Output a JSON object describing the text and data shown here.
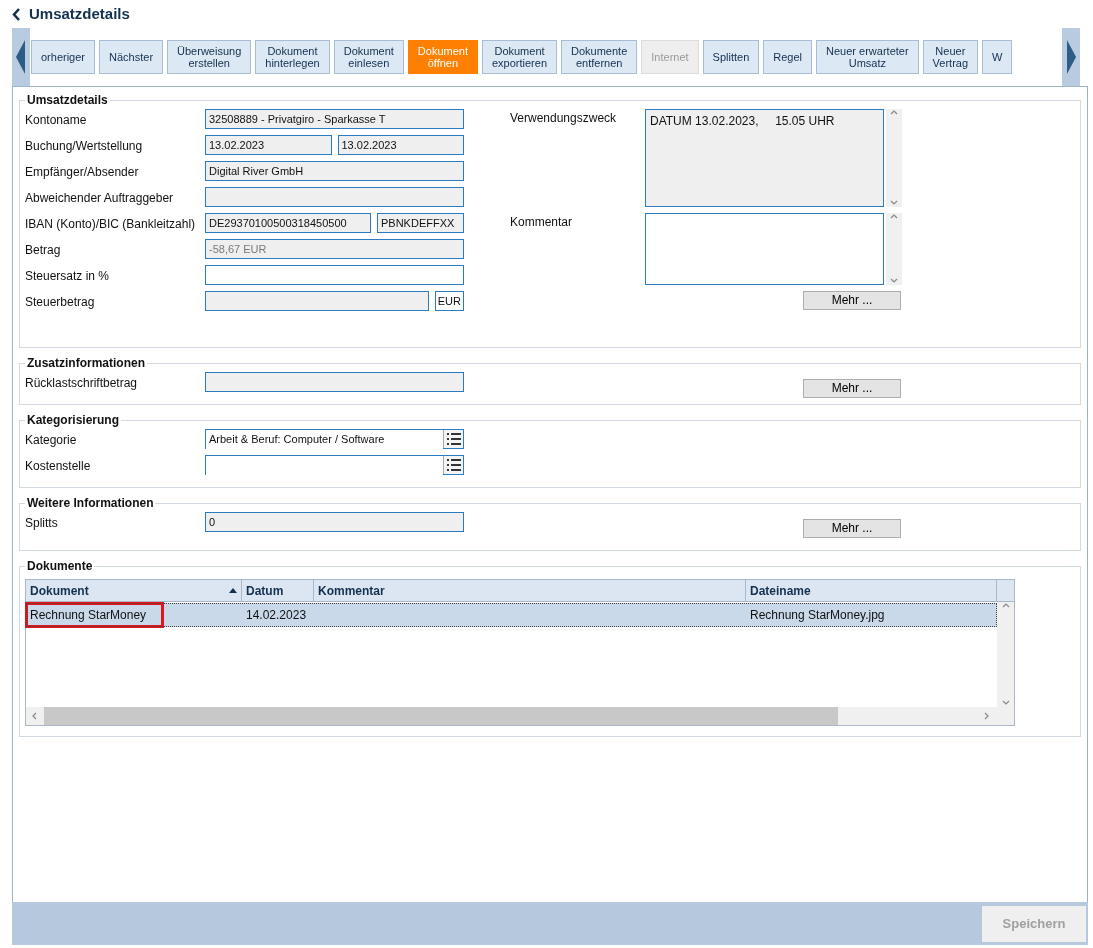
{
  "header": {
    "title": "Umsatzdetails"
  },
  "toolbar": [
    {
      "label": "orheriger",
      "selected": false,
      "disabled": false
    },
    {
      "label": "Nächster",
      "selected": false,
      "disabled": false
    },
    {
      "label": "Überweisung erstellen",
      "selected": false,
      "disabled": false
    },
    {
      "label": "Dokument hinterlegen",
      "selected": false,
      "disabled": false
    },
    {
      "label": "Dokument einlesen",
      "selected": false,
      "disabled": false
    },
    {
      "label": "Dokument öffnen",
      "selected": true,
      "disabled": false
    },
    {
      "label": "Dokument exportieren",
      "selected": false,
      "disabled": false
    },
    {
      "label": "Dokumente entfernen",
      "selected": false,
      "disabled": false
    },
    {
      "label": "Internet",
      "selected": false,
      "disabled": true
    },
    {
      "label": "Splitten",
      "selected": false,
      "disabled": false
    },
    {
      "label": "Regel",
      "selected": false,
      "disabled": false
    },
    {
      "label": "Neuer erwarteter Umsatz",
      "selected": false,
      "disabled": false
    },
    {
      "label": "Neuer Vertrag",
      "selected": false,
      "disabled": false
    },
    {
      "label": "W",
      "selected": false,
      "disabled": false
    }
  ],
  "sections": [
    {
      "title": "Umsatzdetails",
      "rows": [
        {
          "label": "Kontoname",
          "fields": [
            {
              "value": "32508889 - Privatgiro - Sparkasse T",
              "readonly": true
            }
          ]
        },
        {
          "label": "Buchung/Wertstellung",
          "fields": [
            {
              "value": "13.02.2023",
              "readonly": true
            },
            {
              "value": "13.02.2023",
              "readonly": true
            }
          ]
        },
        {
          "label": "Empfänger/Absender",
          "fields": [
            {
              "value": "Digital River GmbH",
              "readonly": true
            }
          ]
        },
        {
          "label": "Abweichender Auftraggeber",
          "fields": [
            {
              "readonly": true
            }
          ]
        },
        {
          "label": "IBAN (Konto)/BIC (Bankleitzahl)",
          "fields": [
            {
              "value": "DE29370100500318450500",
              "readonly": true
            },
            {
              "value": "PBNKDEFFXX",
              "readonly": true
            }
          ]
        },
        {
          "label": "Betrag",
          "fields": [
            {
              "value": "-58,67 EUR",
              "readonly": true,
              "disabled": true
            }
          ]
        },
        {
          "label": "Steuersatz in %",
          "fields": [
            {
              "readonly": false
            }
          ]
        },
        {
          "label": "Steuerbetrag",
          "fields": [
            {
              "readonly": true
            },
            {
              "value": "EUR",
              "readonly": false,
              "narrow": true
            }
          ]
        }
      ],
      "side_fields": [
        {
          "label": "Verwendungszweck",
          "value": "DATUM 13.02.2023,     15.05 UHR",
          "readonly": true
        },
        {
          "label": "Kommentar",
          "readonly": false
        }
      ],
      "more_button": "Mehr ..."
    },
    {
      "title": "Zusatzinformationen",
      "rows": [
        {
          "label": "Rücklastschriftbetrag",
          "fields": [
            {
              "readonly": true
            }
          ]
        }
      ],
      "more_button": "Mehr ..."
    },
    {
      "title": "Kategorisierung",
      "rows": [
        {
          "label": "Kategorie",
          "fields": [
            {
              "value": "Arbeit & Beruf: Computer / Software",
              "readonly": false,
              "picker": true
            }
          ]
        },
        {
          "label": "Kostenstelle",
          "fields": [
            {
              "readonly": false,
              "picker": true
            }
          ]
        }
      ]
    },
    {
      "title": "Weitere Informationen",
      "rows": [
        {
          "label": "Splitts",
          "fields": [
            {
              "value": "0",
              "readonly": true
            }
          ]
        }
      ],
      "more_button": "Mehr ..."
    }
  ],
  "documents": {
    "title": "Dokumente",
    "columns": [
      {
        "label": "Dokument",
        "sorted": true
      },
      {
        "label": "Datum",
        "sorted": false
      },
      {
        "label": "Kommentar",
        "sorted": false
      },
      {
        "label": "Dateiname",
        "sorted": false
      }
    ],
    "rows": [
      {
        "cells": [
          "Rechnung StarMoney",
          "14.02.2023",
          "",
          "Rechnung StarMoney.jpg"
        ],
        "selected": true,
        "highlighted": true
      }
    ]
  },
  "footer": {
    "save_button": "Speichern",
    "save_disabled": true
  }
}
